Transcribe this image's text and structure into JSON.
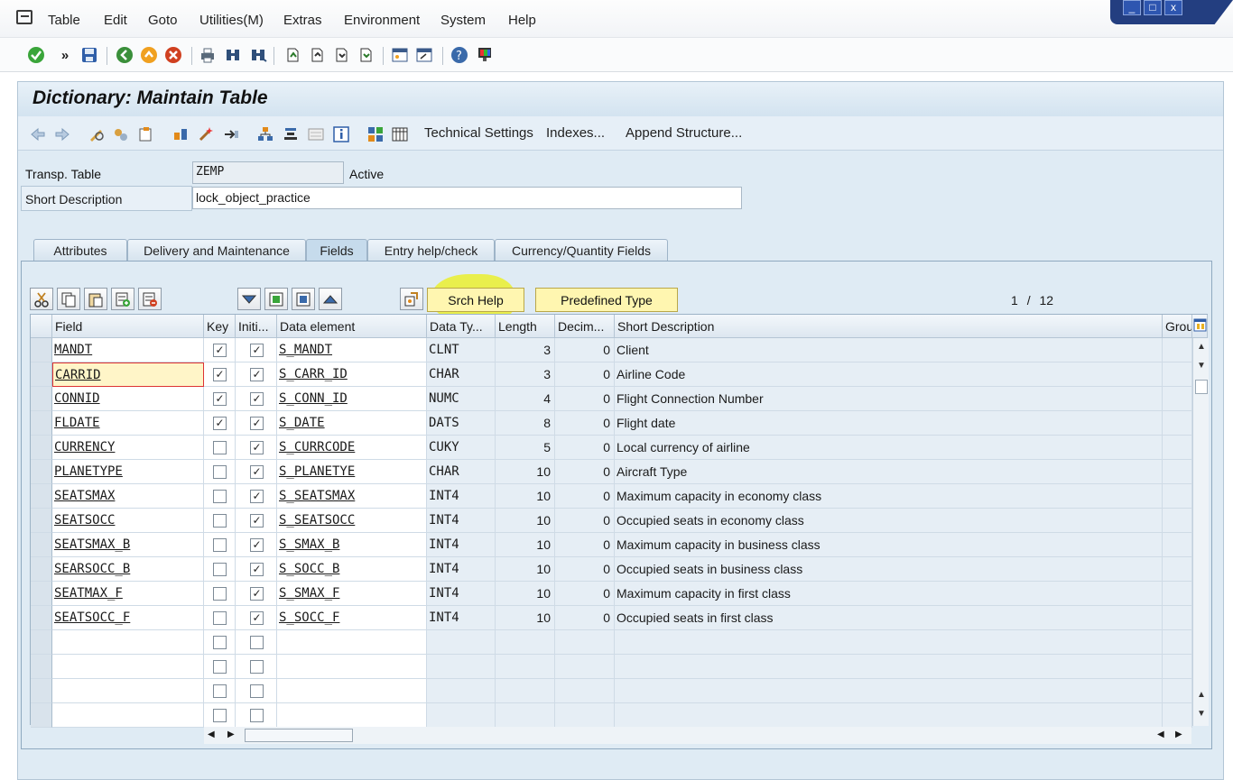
{
  "menu": {
    "items": [
      "Table",
      "Edit",
      "Goto",
      "Utilities(M)",
      "Extras",
      "Environment",
      "System",
      "Help"
    ]
  },
  "window_controls": {
    "minimize": "_",
    "maximize": "□",
    "close": "x"
  },
  "page": {
    "title": "Dictionary: Maintain Table"
  },
  "app_toolbar": {
    "technical_settings": "Technical Settings",
    "indexes": "Indexes...",
    "append_structure": "Append Structure..."
  },
  "header": {
    "table_label": "Transp. Table",
    "table_value": "ZEMP",
    "status": "Active",
    "desc_label": "Short Description",
    "desc_value": "lock_object_practice"
  },
  "tabs": [
    {
      "label": "Attributes",
      "active": false
    },
    {
      "label": "Delivery and Maintenance",
      "active": false
    },
    {
      "label": "Fields",
      "active": true
    },
    {
      "label": "Entry help/check",
      "active": false
    },
    {
      "label": "Currency/Quantity Fields",
      "active": false
    }
  ],
  "table_toolbar": {
    "srch_help": "Srch Help",
    "predefined_type": "Predefined Type",
    "page_current": "1",
    "page_sep": "/",
    "page_total": "12"
  },
  "grid": {
    "columns": [
      "Field",
      "Key",
      "Initi...",
      "Data element",
      "Data Ty...",
      "Length",
      "Decim...",
      "Short Description",
      "Grou"
    ],
    "rows": [
      {
        "field": "MANDT",
        "key": true,
        "init": true,
        "element": "S_MANDT",
        "dtype": "CLNT",
        "length": "3",
        "decimals": "0",
        "desc": "Client"
      },
      {
        "field": "CARRID",
        "key": true,
        "init": true,
        "element": "S_CARR_ID",
        "dtype": "CHAR",
        "length": "3",
        "decimals": "0",
        "desc": "Airline Code"
      },
      {
        "field": "CONNID",
        "key": true,
        "init": true,
        "element": "S_CONN_ID",
        "dtype": "NUMC",
        "length": "4",
        "decimals": "0",
        "desc": "Flight Connection Number"
      },
      {
        "field": "FLDATE",
        "key": true,
        "init": true,
        "element": "S_DATE",
        "dtype": "DATS",
        "length": "8",
        "decimals": "0",
        "desc": "Flight date"
      },
      {
        "field": "CURRENCY",
        "key": false,
        "init": true,
        "element": "S_CURRCODE",
        "dtype": "CUKY",
        "length": "5",
        "decimals": "0",
        "desc": "Local currency of airline"
      },
      {
        "field": "PLANETYPE",
        "key": false,
        "init": true,
        "element": "S_PLANETYE",
        "dtype": "CHAR",
        "length": "10",
        "decimals": "0",
        "desc": "Aircraft Type"
      },
      {
        "field": "SEATSMAX",
        "key": false,
        "init": true,
        "element": "S_SEATSMAX",
        "dtype": "INT4",
        "length": "10",
        "decimals": "0",
        "desc": "Maximum capacity in economy class"
      },
      {
        "field": "SEATSOCC",
        "key": false,
        "init": true,
        "element": "S_SEATSOCC",
        "dtype": "INT4",
        "length": "10",
        "decimals": "0",
        "desc": "Occupied seats in economy class"
      },
      {
        "field": "SEATSMAX_B",
        "key": false,
        "init": true,
        "element": "S_SMAX_B",
        "dtype": "INT4",
        "length": "10",
        "decimals": "0",
        "desc": "Maximum capacity in business class"
      },
      {
        "field": "SEARSOCC_B",
        "key": false,
        "init": true,
        "element": "S_SOCC_B",
        "dtype": "INT4",
        "length": "10",
        "decimals": "0",
        "desc": "Occupied seats in business class"
      },
      {
        "field": "SEATMAX_F",
        "key": false,
        "init": true,
        "element": "S_SMAX_F",
        "dtype": "INT4",
        "length": "10",
        "decimals": "0",
        "desc": "Maximum capacity in first class"
      },
      {
        "field": "SEATSOCC_F",
        "key": false,
        "init": true,
        "element": "S_SOCC_F",
        "dtype": "INT4",
        "length": "10",
        "decimals": "0",
        "desc": "Occupied seats in first class"
      },
      {
        "field": "",
        "key": false,
        "init": false,
        "element": "",
        "dtype": "",
        "length": "",
        "decimals": "",
        "desc": ""
      },
      {
        "field": "",
        "key": false,
        "init": false,
        "element": "",
        "dtype": "",
        "length": "",
        "decimals": "",
        "desc": ""
      },
      {
        "field": "",
        "key": false,
        "init": false,
        "element": "",
        "dtype": "",
        "length": "",
        "decimals": "",
        "desc": ""
      },
      {
        "field": "",
        "key": false,
        "init": false,
        "element": "",
        "dtype": "",
        "length": "",
        "decimals": "",
        "desc": ""
      }
    ]
  },
  "colors": {
    "accent": "#233e80",
    "highlight": "#ecf014",
    "button_yellow": "#fff6b0"
  },
  "icons": {
    "standard_toolbar": [
      "enter-icon",
      "command-field-icon",
      "save-icon",
      "back-icon",
      "exit-icon",
      "cancel-icon",
      "print-icon",
      "find-icon",
      "find-next-icon",
      "first-page-icon",
      "previous-page-icon",
      "next-page-icon",
      "last-page-icon",
      "new-session-icon",
      "shortcut-icon",
      "help-icon",
      "customize-layout-icon"
    ]
  }
}
